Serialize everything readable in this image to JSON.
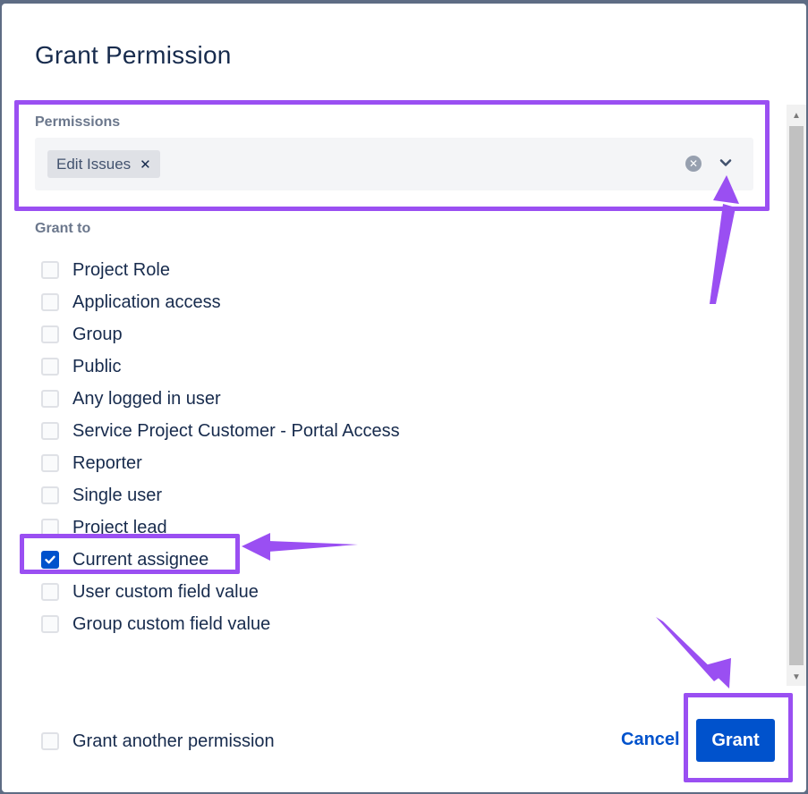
{
  "dialog": {
    "title": "Grant Permission"
  },
  "permissions": {
    "label": "Permissions",
    "selected_tag": "Edit Issues",
    "tag_remove_glyph": "✕",
    "clear_glyph": "✕"
  },
  "grant_to": {
    "label": "Grant to",
    "options": [
      {
        "label": "Project Role",
        "checked": false
      },
      {
        "label": "Application access",
        "checked": false
      },
      {
        "label": "Group",
        "checked": false
      },
      {
        "label": "Public",
        "checked": false
      },
      {
        "label": "Any logged in user",
        "checked": false
      },
      {
        "label": "Service Project Customer - Portal Access",
        "checked": false
      },
      {
        "label": "Reporter",
        "checked": false
      },
      {
        "label": "Single user",
        "checked": false
      },
      {
        "label": "Project lead",
        "checked": false
      },
      {
        "label": "Current assignee",
        "checked": true
      },
      {
        "label": "User custom field value",
        "checked": false
      },
      {
        "label": "Group custom field value",
        "checked": false
      }
    ]
  },
  "footer": {
    "grant_another_label": "Grant another permission",
    "cancel_label": "Cancel",
    "grant_label": "Grant"
  },
  "colors": {
    "primary": "#0052cc",
    "annotation": "#9a4ff2",
    "text": "#172b4d",
    "subtle": "#6b778c"
  },
  "icons": {
    "clear": "clear-icon",
    "dropdown": "chevron-down-icon",
    "check": "check-icon"
  }
}
